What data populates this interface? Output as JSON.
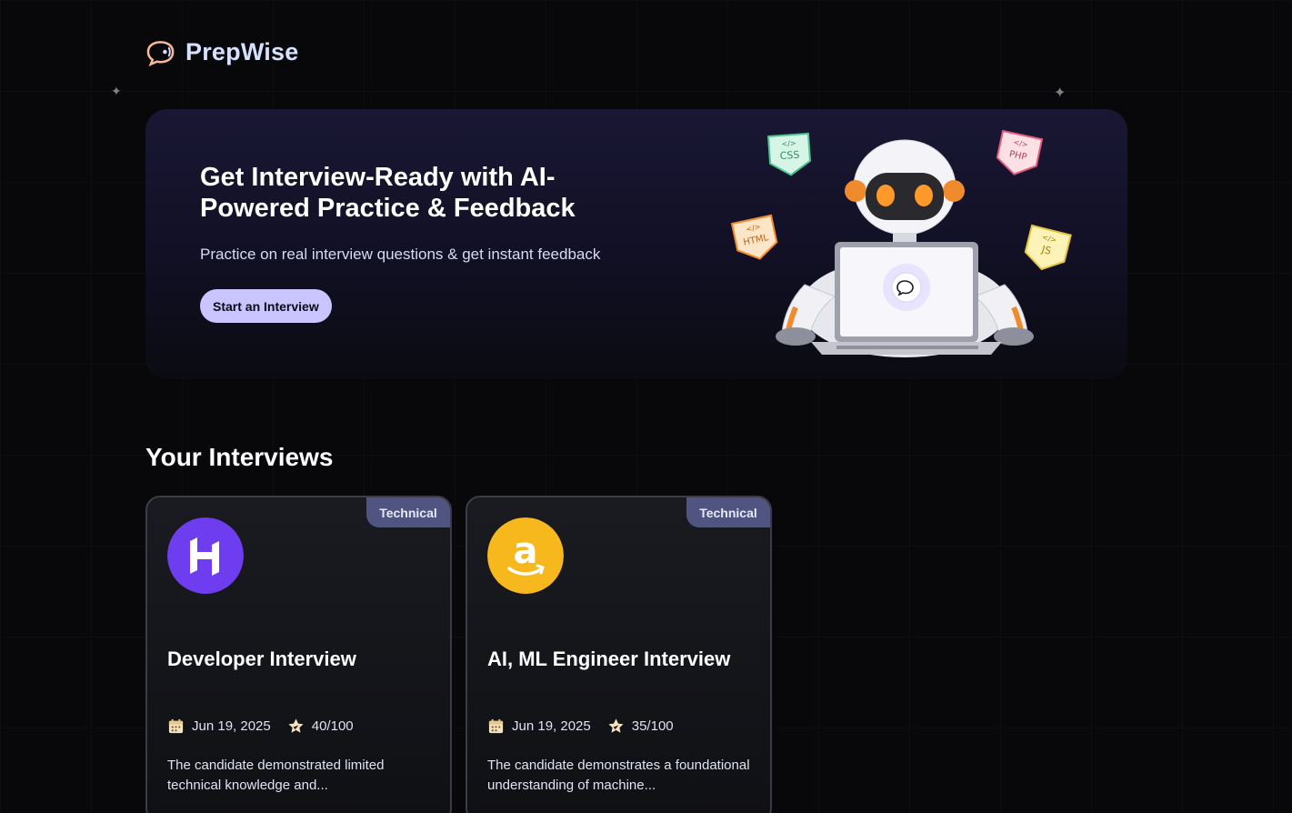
{
  "brand": {
    "name": "PrepWise"
  },
  "hero": {
    "title": "Get Interview-Ready with AI-Powered Practice & Feedback",
    "subtitle": "Practice on real interview questions & get instant feedback",
    "cta_label": "Start an Interview",
    "tech_tags": [
      "CSS",
      "PHP",
      "HTML",
      "JS"
    ]
  },
  "interviews": {
    "section_title": "Your Interviews",
    "cards": [
      {
        "badge": "Technical",
        "title": "Developer Interview",
        "date": "Jun 19, 2025",
        "score": "40/100",
        "description": "The candidate demonstrated limited technical knowledge and...",
        "logo_color": "#6f3df0"
      },
      {
        "badge": "Technical",
        "title": "AI, ML Engineer Interview",
        "date": "Jun 19, 2025",
        "score": "35/100",
        "description": "The candidate demonstrates a foundational understanding of machine...",
        "logo_color": "#f6b81c"
      }
    ]
  },
  "colors": {
    "accent": "#cac5fe",
    "badge_bg": "#4f5580",
    "background": "#08080a"
  }
}
